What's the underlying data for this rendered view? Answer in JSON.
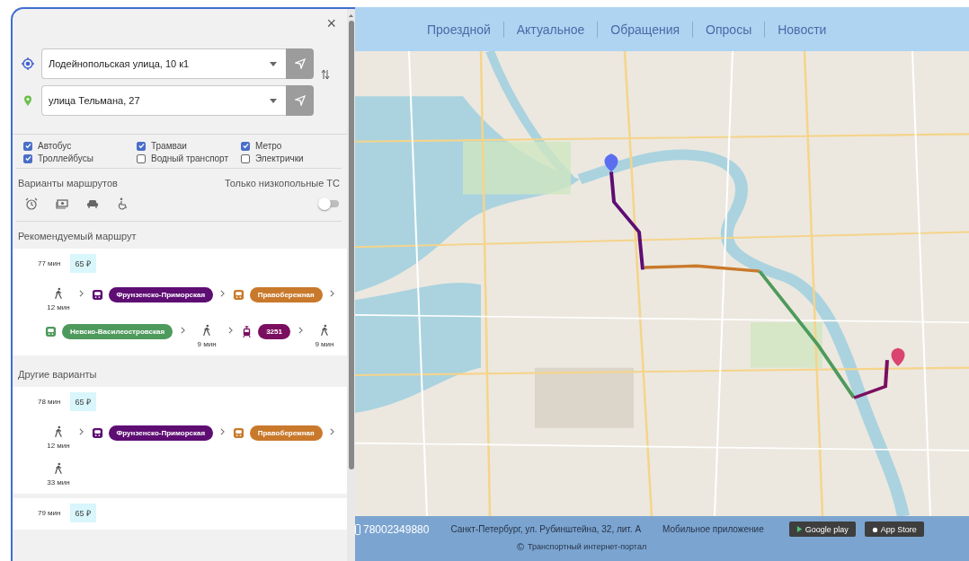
{
  "panel": {
    "close": "×",
    "origin": {
      "value": "Лодейнопольская улица, 10 к1"
    },
    "destination": {
      "value": "улица Тельмана, 27"
    },
    "transport": [
      {
        "label": "Автобус",
        "checked": true
      },
      {
        "label": "Трамваи",
        "checked": true
      },
      {
        "label": "Метро",
        "checked": true
      },
      {
        "label": "Троллейбусы",
        "checked": true
      },
      {
        "label": "Водный транспорт",
        "checked": false
      },
      {
        "label": "Электрички",
        "checked": false
      }
    ],
    "route_options_label": "Варианты маршрутов",
    "low_floor": {
      "label": "Только низкопольные ТС",
      "on": false
    },
    "recommended": {
      "title": "Рекомендуемый маршрут",
      "routes": [
        {
          "time": "77 мин",
          "price": "65 ₽",
          "legs": [
            {
              "kind": "walk",
              "duration": "12 мин"
            },
            {
              "kind": "metro",
              "name": "Фрунзенско-Приморская",
              "color": "#5e0d73"
            },
            {
              "kind": "metro",
              "name": "Правобережная",
              "color": "#c9792b"
            },
            {
              "kind": "metro",
              "name": "Невско-Василеостровская",
              "color": "#4e9a5c"
            },
            {
              "kind": "walk",
              "duration": "9 мин"
            },
            {
              "kind": "tram",
              "name": "3251",
              "color": "#7b0f5f"
            },
            {
              "kind": "walk",
              "duration": "9 мин"
            }
          ]
        }
      ]
    },
    "others": {
      "title": "Другие варианты",
      "routes": [
        {
          "time": "78 мин",
          "price": "65 ₽",
          "legs": [
            {
              "kind": "walk",
              "duration": "12 мин"
            },
            {
              "kind": "metro",
              "name": "Фрунзенско-Приморская",
              "color": "#5e0d73"
            },
            {
              "kind": "metro",
              "name": "Правобережная",
              "color": "#c9792b"
            },
            {
              "kind": "walk",
              "duration": "33 мин"
            }
          ]
        },
        {
          "time": "79 мин",
          "price": "65 ₽"
        }
      ]
    }
  },
  "header": {
    "nav": [
      {
        "label": "Проездной"
      },
      {
        "label": "Актуальное"
      },
      {
        "label": "Обращения"
      },
      {
        "label": "Опросы"
      },
      {
        "label": "Новости"
      }
    ]
  },
  "footer": {
    "phone": "78002349880",
    "address": "Санкт-Петербург, ул. Рубинштейна, 32, лит. А",
    "mobile_app": "Мобильное приложение",
    "stores": [
      {
        "kind": "google",
        "label": "Google play"
      },
      {
        "kind": "apple",
        "label": "App Store"
      }
    ],
    "copyright_mark": "©",
    "copyright": "Транспортный интернет-портал"
  }
}
